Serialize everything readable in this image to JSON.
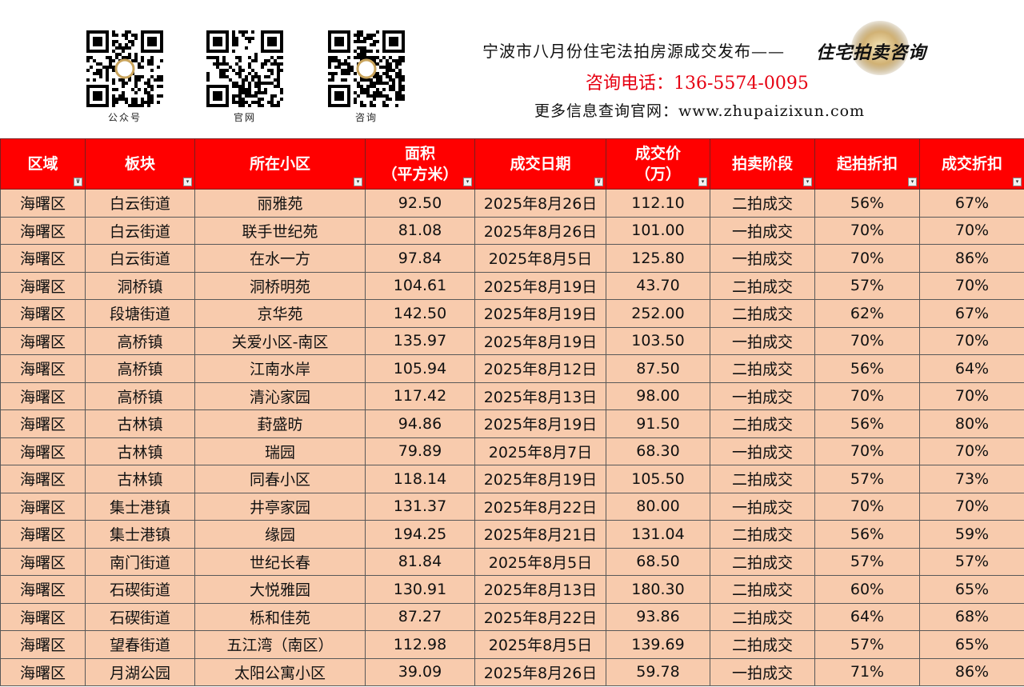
{
  "qr_codes": [
    {
      "caption": "公众号"
    },
    {
      "caption": "官网"
    },
    {
      "caption": "咨询"
    }
  ],
  "header": {
    "headline": "宁波市八月份住宅法拍房源成交发布——",
    "brand": "住宅拍卖咨询",
    "phone": "咨询电话：136-5574-0095",
    "website": "更多信息查询官网：www.zhupaizixun.com"
  },
  "colors": {
    "header_bg": "#ff0000",
    "row_bg": "#f8cbad",
    "phone_text": "#e60012"
  },
  "table": {
    "columns": [
      {
        "label": "区域",
        "filter": "filter-active-icon"
      },
      {
        "label": "板块",
        "filter": "dropdown-icon"
      },
      {
        "label": "所在小区",
        "filter": "dropdown-icon"
      },
      {
        "label": "面积\n（平方米）",
        "filter": "dropdown-icon"
      },
      {
        "label": "成交日期",
        "filter": "filter-active-icon"
      },
      {
        "label": "成交价\n（万）",
        "filter": "dropdown-icon"
      },
      {
        "label": "拍卖阶段",
        "filter": "dropdown-icon"
      },
      {
        "label": "起拍折扣",
        "filter": "dropdown-icon"
      },
      {
        "label": "成交折扣",
        "filter": "dropdown-icon"
      }
    ],
    "rows": [
      [
        "海曙区",
        "白云街道",
        "丽雅苑",
        "92.50",
        "2025年8月26日",
        "112.10",
        "二拍成交",
        "56%",
        "67%"
      ],
      [
        "海曙区",
        "白云街道",
        "联手世纪苑",
        "81.08",
        "2025年8月26日",
        "101.00",
        "一拍成交",
        "70%",
        "70%"
      ],
      [
        "海曙区",
        "白云街道",
        "在水一方",
        "97.84",
        "2025年8月5日",
        "125.80",
        "一拍成交",
        "70%",
        "86%"
      ],
      [
        "海曙区",
        "洞桥镇",
        "洞桥明苑",
        "104.61",
        "2025年8月19日",
        "43.70",
        "二拍成交",
        "57%",
        "70%"
      ],
      [
        "海曙区",
        "段塘街道",
        "京华苑",
        "142.50",
        "2025年8月19日",
        "252.00",
        "二拍成交",
        "62%",
        "67%"
      ],
      [
        "海曙区",
        "高桥镇",
        "关爱小区-南区",
        "135.97",
        "2025年8月19日",
        "103.50",
        "一拍成交",
        "70%",
        "70%"
      ],
      [
        "海曙区",
        "高桥镇",
        "江南水岸",
        "105.94",
        "2025年8月12日",
        "87.50",
        "二拍成交",
        "56%",
        "64%"
      ],
      [
        "海曙区",
        "高桥镇",
        "清沁家园",
        "117.42",
        "2025年8月13日",
        "98.00",
        "一拍成交",
        "70%",
        "70%"
      ],
      [
        "海曙区",
        "古林镇",
        "葑盛昉",
        "94.86",
        "2025年8月19日",
        "91.50",
        "二拍成交",
        "56%",
        "80%"
      ],
      [
        "海曙区",
        "古林镇",
        "瑞园",
        "79.89",
        "2025年8月7日",
        "68.30",
        "一拍成交",
        "70%",
        "70%"
      ],
      [
        "海曙区",
        "古林镇",
        "同春小区",
        "118.14",
        "2025年8月19日",
        "105.50",
        "二拍成交",
        "57%",
        "73%"
      ],
      [
        "海曙区",
        "集士港镇",
        "井亭家园",
        "131.37",
        "2025年8月22日",
        "80.00",
        "一拍成交",
        "70%",
        "70%"
      ],
      [
        "海曙区",
        "集士港镇",
        "缘园",
        "194.25",
        "2025年8月21日",
        "131.04",
        "二拍成交",
        "56%",
        "59%"
      ],
      [
        "海曙区",
        "南门街道",
        "世纪长春",
        "81.84",
        "2025年8月5日",
        "68.50",
        "二拍成交",
        "57%",
        "57%"
      ],
      [
        "海曙区",
        "石碶街道",
        "大悦雅园",
        "130.91",
        "2025年8月13日",
        "180.30",
        "二拍成交",
        "60%",
        "65%"
      ],
      [
        "海曙区",
        "石碶街道",
        "栎和佳苑",
        "87.27",
        "2025年8月22日",
        "93.86",
        "二拍成交",
        "64%",
        "68%"
      ],
      [
        "海曙区",
        "望春街道",
        "五江湾（南区）",
        "112.98",
        "2025年8月5日",
        "139.69",
        "二拍成交",
        "57%",
        "65%"
      ],
      [
        "海曙区",
        "月湖公园",
        "太阳公寓小区",
        "39.09",
        "2025年8月26日",
        "59.78",
        "一拍成交",
        "71%",
        "86%"
      ]
    ]
  }
}
